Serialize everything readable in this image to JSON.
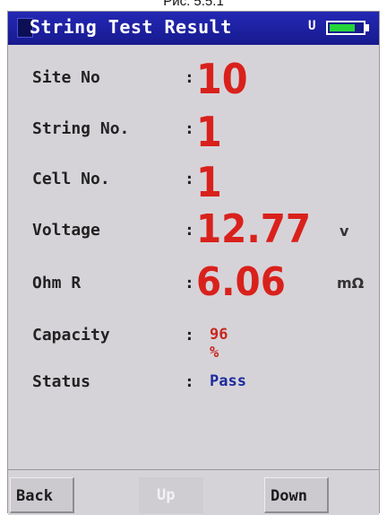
{
  "caption": "Рис. 5.5.1",
  "title": "String Test Result",
  "status_bar": {
    "usb_label": "U",
    "battery_level": 0.78,
    "battery_color": "#23d63a"
  },
  "fields": {
    "site": {
      "label": "Site No",
      "value": "10"
    },
    "string": {
      "label": "String No.",
      "value": "1"
    },
    "cell": {
      "label": "Cell No.",
      "value": "1"
    },
    "voltage": {
      "label": "Voltage",
      "value": "12.77",
      "unit": "v"
    },
    "ohm": {
      "label": "Ohm R",
      "value": "6.06",
      "unit": "mΩ"
    },
    "capacity": {
      "label": "Capacity",
      "value": "96 %"
    },
    "status": {
      "label": "Status",
      "value": "Pass"
    }
  },
  "separator": ":",
  "colors": {
    "value_red": "#d9211c",
    "pass_blue": "#1d2a9e",
    "title_bar": "#2428b5"
  },
  "buttons": {
    "back": "Back",
    "up": "Up",
    "down": "Down"
  }
}
